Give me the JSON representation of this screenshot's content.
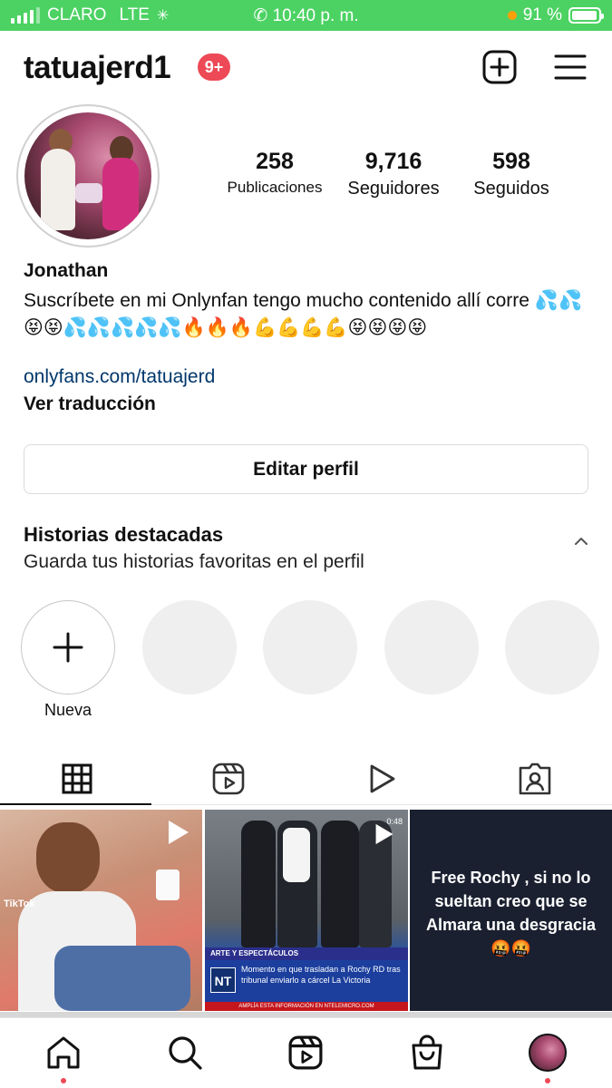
{
  "status_bar": {
    "carrier": "CLARO",
    "network": "LTE",
    "time": "10:40 p. m.",
    "battery": "91 %",
    "battery_level": 0.91,
    "background_color": "#4cd263"
  },
  "header": {
    "username": "tatuajerd1",
    "notification_badge": "9+",
    "badge_color": "#ed4956",
    "icons": [
      "new-post-icon",
      "menu-icon"
    ]
  },
  "profile": {
    "stats": [
      {
        "value": "258",
        "label": "Publicaciones"
      },
      {
        "value": "9,716",
        "label": "Seguidores"
      },
      {
        "value": "598",
        "label": "Seguidos"
      }
    ],
    "name": "Jonathan",
    "bio": "Suscríbete en mi Onlynfan tengo mucho contenido allí corre 💦💦😝😝💦💦💦💦💦🔥🔥🔥💪💪💪💪😝😝😝😝",
    "link": "onlyfans.com/tatuajerd",
    "link_color": "#00376b",
    "translate": "Ver traducción",
    "edit_button": "Editar perfil"
  },
  "highlights": {
    "title": "Historias destacadas",
    "subtitle": "Guarda tus historias favoritas en el perfil",
    "new_label": "Nueva"
  },
  "tabs": [
    "grid-icon",
    "reels-icon",
    "video-play-icon",
    "tagged-icon"
  ],
  "posts": [
    {
      "overlay": "TikTok",
      "type": "reel"
    },
    {
      "type": "reel",
      "duration": "0:48",
      "tag": "ARTE Y ESPECTÁCULOS",
      "logo": "NT",
      "headline": "Momento en que trasladan a Rochy RD tras tribunal enviarlo a cárcel La Victoria",
      "footer": "AMPLÍA ESTA INFORMACIÓN EN NTELEMICRO.COM"
    },
    {
      "type": "image",
      "text": "Free Rochy , si no lo sueltan creo que se Almara una desgracia 🤬🤬"
    }
  ],
  "bottom_nav": [
    "home-icon",
    "search-icon",
    "reels-icon",
    "shop-icon",
    "profile-avatar"
  ]
}
